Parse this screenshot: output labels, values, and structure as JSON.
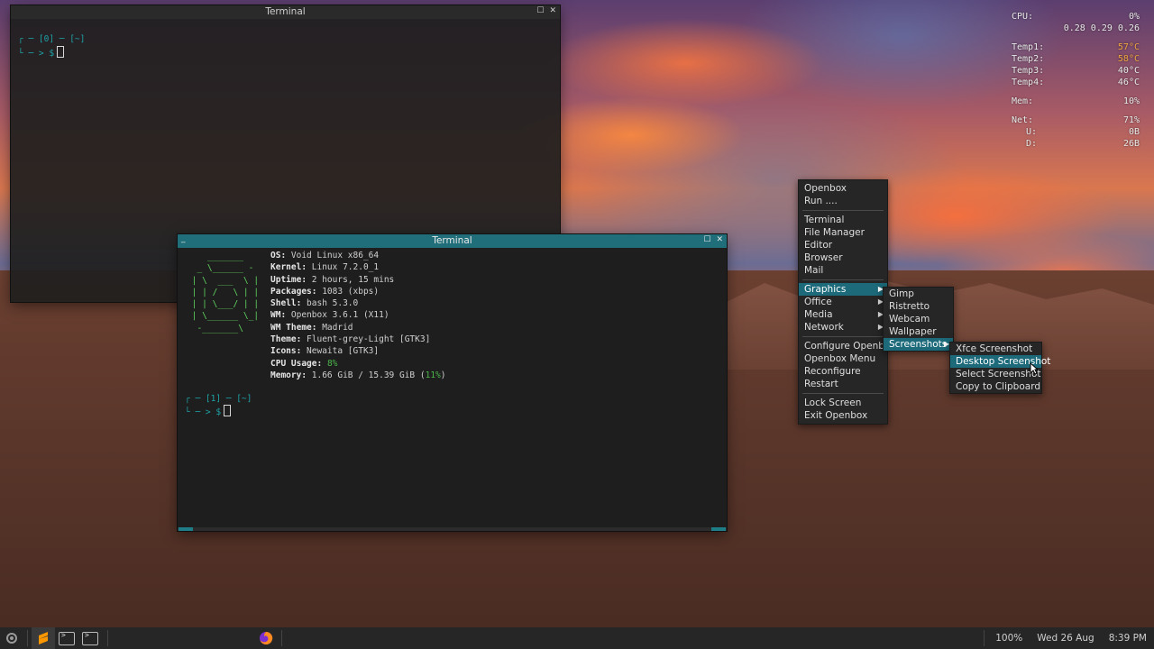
{
  "conky": {
    "cpu_label": "CPU:",
    "cpu_value": "0%",
    "load": "0.28 0.29 0.26",
    "temps": [
      {
        "label": "Temp1:",
        "value": "57°C",
        "warm": true
      },
      {
        "label": "Temp2:",
        "value": "58°C",
        "warm": true
      },
      {
        "label": "Temp3:",
        "value": "40°C",
        "warm": false
      },
      {
        "label": "Temp4:",
        "value": "46°C",
        "warm": false
      }
    ],
    "mem_label": "Mem:",
    "mem_value": "10%",
    "net_label": "Net:",
    "net_value": "71%",
    "up_label": "U:",
    "up_value": "0B",
    "down_label": "D:",
    "down_value": "26B"
  },
  "win1": {
    "title": "Terminal",
    "prompt_top": "┌ ─ [0] ─ [~]",
    "prompt_bottom": "└ ─ > $"
  },
  "win2": {
    "title": "Terminal",
    "logo": [
      "    _______",
      "  _ \\______ -",
      " | \\  ___  \\ |",
      " | | /   \\ | |",
      " | | \\___/ | |",
      " | \\______ \\_|",
      "  -_______\\"
    ],
    "info": [
      {
        "label": "OS:",
        "value": " Void Linux x86_64"
      },
      {
        "label": "Kernel:",
        "value": " Linux 7.2.0_1"
      },
      {
        "label": "Uptime:",
        "value": " 2 hours, 15 mins"
      },
      {
        "label": "Packages:",
        "value": " 1083 (xbps)"
      },
      {
        "label": "Shell:",
        "value": " bash 5.3.0"
      },
      {
        "label": "WM:",
        "value": " Openbox 3.6.1 (X11)"
      },
      {
        "label": "WM Theme:",
        "value": " Madrid"
      },
      {
        "label": "Theme:",
        "value": " Fluent-grey-Light [GTK3]"
      },
      {
        "label": "Icons:",
        "value": " Newaita [GTK3]"
      }
    ],
    "cpu_label": "CPU Usage:",
    "cpu_value": "8%",
    "mem_label": "Memory:",
    "mem_value": " 1.66 GiB / 15.39 GiB (",
    "mem_pct": "11%",
    "mem_close": ")",
    "prompt_top": "┌ ─ [1] ─ [~]",
    "prompt_bottom": "└ ─ > $"
  },
  "menu_root": {
    "groups": [
      [
        "Openbox",
        "Run ...."
      ],
      [
        "Terminal",
        "File Manager",
        "Editor",
        "Browser",
        "Mail"
      ],
      [
        "Graphics",
        "Office",
        "Media",
        "Network"
      ],
      [
        "Configure Openbox",
        "Openbox Menu",
        "Reconfigure",
        "Restart"
      ],
      [
        "Lock Screen",
        "Exit Openbox"
      ]
    ]
  },
  "menu_graphics": [
    "Gimp",
    "Ristretto",
    "Webcam",
    "Wallpaper",
    "Screenshots"
  ],
  "menu_shots": [
    "Xfce Screenshot",
    "Desktop Screenshot",
    "Select Screenshot",
    "Copy to Clipboard"
  ],
  "taskbar": {
    "volume": "100%",
    "date": "Wed 26 Aug",
    "time": "8:39 PM"
  }
}
